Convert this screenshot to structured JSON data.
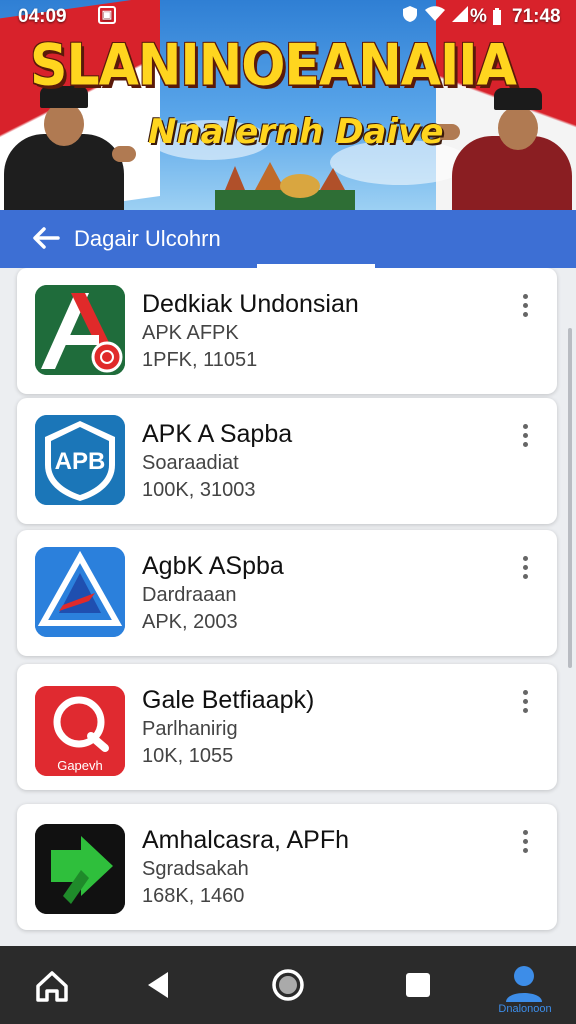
{
  "status_bar": {
    "time_left": "04:09",
    "battery": "%",
    "time_right": "71:48"
  },
  "banner": {
    "title": "SLANINOEANAIIA",
    "subtitle": "Nnalernh Daive"
  },
  "toolbar": {
    "title": "Dagair Ulcohrn"
  },
  "apps": [
    {
      "name": "Dedkiak Undonsian",
      "subtitle": "APK AFPK",
      "meta": "1PFK, 11051",
      "icon": "letter-a-icon",
      "icon_bg": "#1c6b3a"
    },
    {
      "name": "APK A Sapba",
      "subtitle": "Soaraadiat",
      "meta": "100K, 31003",
      "icon": "apb-shield-icon",
      "icon_bg": "#1b7fbf",
      "icon_text": "APB"
    },
    {
      "name": "AgbK ASpba",
      "subtitle": "Dardraaan",
      "meta": "APK, 2003",
      "icon": "triangle-a-icon",
      "icon_bg": "#2a7fdc"
    },
    {
      "name": "Gale Betfiaapk)",
      "subtitle": "Parlhanirig",
      "meta": "10K, 1055",
      "icon": "search-q-icon",
      "icon_bg": "#e12a2f",
      "icon_text": "Gapevh"
    },
    {
      "name": "Amhalcasra, APFh",
      "subtitle": "Sgradsakah",
      "meta": "168K, 1460",
      "icon": "green-arrow-icon",
      "icon_bg": "#111111"
    }
  ],
  "navbar": {
    "items": [
      "home-icon",
      "back-icon",
      "home-circle-icon",
      "recents-icon",
      "profile-icon"
    ],
    "profile_label": "Dnalonoon"
  }
}
